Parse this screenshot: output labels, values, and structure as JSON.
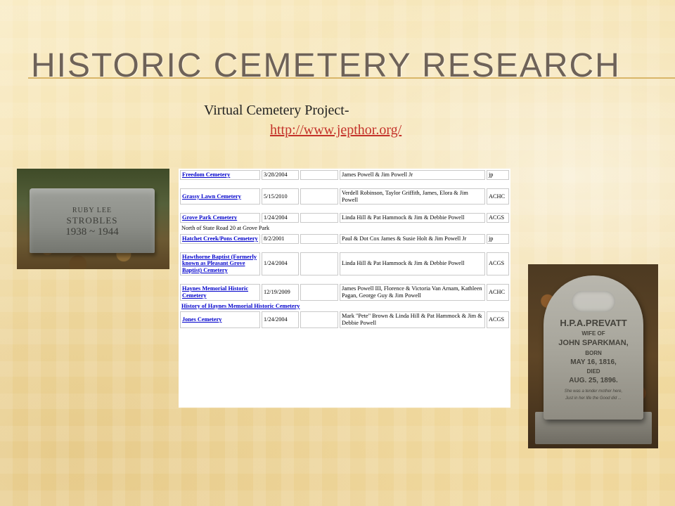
{
  "slide": {
    "title": "HISTORIC CEMETERY RESEARCH",
    "subtitle": "Virtual Cemetery Project-",
    "link": "http://www.jepthor.org/"
  },
  "photo_left": {
    "lines": [
      "RUBY LEE",
      "STROBLES",
      "1938 ~ 1944"
    ]
  },
  "photo_right": {
    "lines": [
      "H.P.A.PREVATT",
      "WIFE OF",
      "JOHN SPARKMAN,",
      "BORN",
      "MAY 16, 1816,",
      "DIED",
      "AUG. 25, 1896.",
      "She was a tender mother here,",
      "Just in her life the Good did ..."
    ]
  },
  "colors": {
    "title": "#6e6258",
    "rule": "#d9b66a",
    "link": "#c4322a",
    "table_link": "#0000cc"
  },
  "table": {
    "rows": [
      {
        "type": "data",
        "name": "Freedom Cemetery",
        "date": "3/28/2004",
        "people": "James Powell & Jim Powell Jr",
        "org": "jp"
      },
      {
        "type": "spacer"
      },
      {
        "type": "data",
        "name": "Grassy Lawn Cemetery",
        "date": "5/15/2010",
        "people": "Verdell Robinson, Taylor Griffith, James, Elora & Jim Powell",
        "org": "ACHC"
      },
      {
        "type": "spacer"
      },
      {
        "type": "data",
        "name": "Grove Park Cemetery",
        "date": "1/24/2004",
        "people": "Linda Hill & Pat Hammock & Jim & Debbie Powell",
        "org": "ACGS"
      },
      {
        "type": "note",
        "text": "North of State Road 20 at Grove Park",
        "link": false
      },
      {
        "type": "data",
        "name": "Hatchet Creek/Pons Cemetery",
        "date": "8/2/2001",
        "people": "Paul & Dot Cox James & Susie Holt & Jim Powell Jr",
        "org": "jp"
      },
      {
        "type": "spacer"
      },
      {
        "type": "data",
        "name": "Hawthorne Baptist (Formerly known as Pleasant Grove Baptist) Cemetery",
        "date": "1/24/2004",
        "people": "Linda Hill & Pat Hammock & Jim & Debbie Powell",
        "org": "ACGS"
      },
      {
        "type": "spacer"
      },
      {
        "type": "data",
        "name": "Haynes Memorial Historic Cemetery",
        "date": "12/19/2009",
        "people": "James Powell III, Florence & Victoria Van Arnam, Kathleen Pagan, George Guy & Jim Powell",
        "org": "ACHC"
      },
      {
        "type": "note",
        "text": "History of Haynes Memorial Historic Cemetery",
        "link": true
      },
      {
        "type": "data",
        "name": "Jones Cemetery",
        "date": "1/24/2004",
        "people": "Mark \"Pete\" Brown & Linda Hill & Pat Hammock & Jim & Debbie Powell",
        "org": "ACGS"
      }
    ]
  }
}
